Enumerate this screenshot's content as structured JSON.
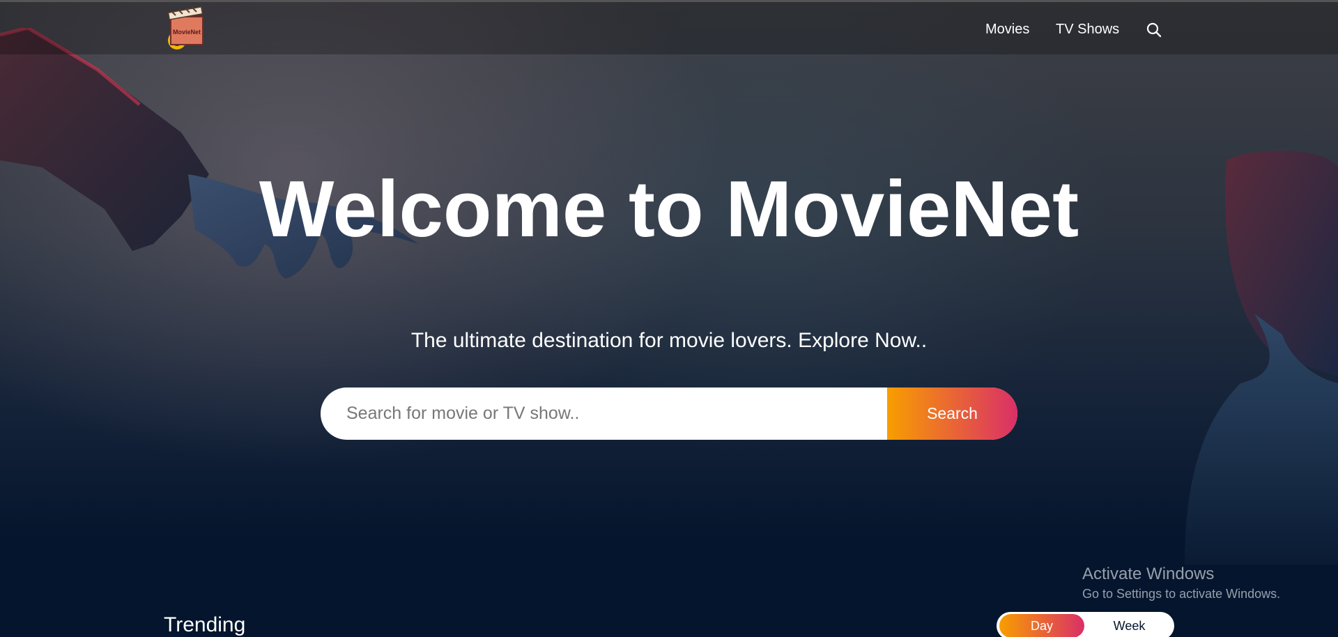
{
  "app": {
    "logo_text": "MovieNet"
  },
  "nav": {
    "items": [
      {
        "label": "Movies"
      },
      {
        "label": "TV Shows"
      }
    ],
    "search_icon": "search-icon"
  },
  "hero": {
    "title": "Welcome to MovieNet",
    "subtitle": "The ultimate destination for movie lovers. Explore Now..",
    "search": {
      "placeholder": "Search for movie or TV show..",
      "value": "",
      "button_label": "Search"
    }
  },
  "trending": {
    "heading": "Trending",
    "toggle": {
      "options": [
        "Day",
        "Week"
      ],
      "selected": "Day"
    }
  },
  "os_overlay": {
    "title": "Activate Windows",
    "subtitle": "Go to Settings to activate Windows."
  },
  "colors": {
    "gradient_start": "#f89e00",
    "gradient_end": "#da2f68",
    "background": "#04152d"
  }
}
